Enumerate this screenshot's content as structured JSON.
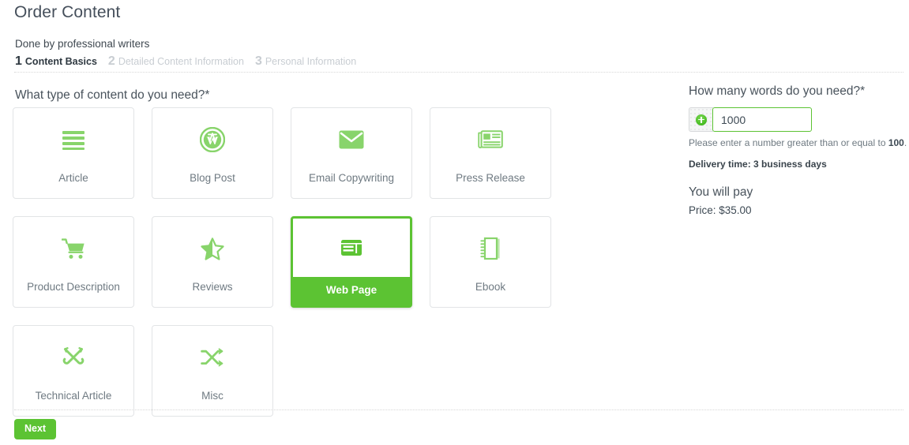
{
  "header": {
    "title": "Order Content",
    "subtitle": "Done by professional writers"
  },
  "steps": [
    {
      "num": "1",
      "label": "Content Basics",
      "state": "active"
    },
    {
      "num": "2",
      "label": "Detailed Content Information",
      "state": "inactive"
    },
    {
      "num": "3",
      "label": "Personal Information",
      "state": "inactive"
    }
  ],
  "content_types": {
    "question": "What type of content do you need?*",
    "selected": "Web Page",
    "options": [
      {
        "label": "Article",
        "icon": "list-lines-icon",
        "selected": false
      },
      {
        "label": "Blog Post",
        "icon": "wordpress-icon",
        "selected": false
      },
      {
        "label": "Email Copywriting",
        "icon": "envelope-icon",
        "selected": false
      },
      {
        "label": "Press Release",
        "icon": "newspaper-icon",
        "selected": false
      },
      {
        "label": "Product Description",
        "icon": "shopping-cart-icon",
        "selected": false
      },
      {
        "label": "Reviews",
        "icon": "half-star-icon",
        "selected": false
      },
      {
        "label": "Web Page",
        "icon": "browser-layout-icon",
        "selected": true
      },
      {
        "label": "Ebook",
        "icon": "notebook-icon",
        "selected": false
      },
      {
        "label": "Technical Article",
        "icon": "tools-icon",
        "selected": false
      },
      {
        "label": "Misc",
        "icon": "shuffle-icon",
        "selected": false
      }
    ]
  },
  "word_count": {
    "question": "How many words do you need?*",
    "addon_icon": "plus-circle-icon",
    "value": "1000",
    "placeholder": "1000",
    "help_prefix": "Please enter a number greater than or equal to ",
    "help_min": "100",
    "help_suffix": ".",
    "delivery": "Delivery time: 3 business days"
  },
  "summary": {
    "title": "You will pay",
    "price": "Price: $35.00"
  },
  "footer": {
    "next_label": "Next"
  },
  "colors": {
    "accent_green": "#5cc333",
    "icon_green": "#88d46b",
    "text_dark": "#3e4a54",
    "text_muted": "#6f7a82",
    "step_inactive": "#c8cdd2",
    "card_border": "#e2e4e6"
  }
}
